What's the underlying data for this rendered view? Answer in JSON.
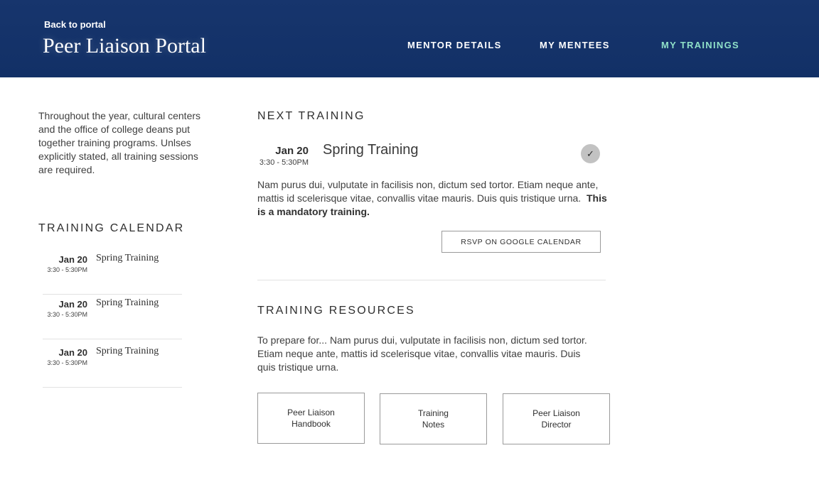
{
  "header": {
    "back_label": "Back to portal",
    "title": "Peer Liaison Portal",
    "nav": [
      "MENTOR DETAILS",
      "MY MENTEES",
      "MY TRAININGS"
    ],
    "active_nav": "MY TRAININGS",
    "colors": {
      "background": "#17356d",
      "active_nav": "#8fe0c8"
    }
  },
  "sidebar": {
    "intro": "Throughout the year, cultural centers and the office of college deans put together training programs. Unlses explicitly stated, all training sessions are required.",
    "calendar_heading": "TRAINING CALENDAR",
    "calendar": [
      {
        "date": "Jan 20",
        "time": "3:30 - 5:30PM",
        "name": "Spring Training"
      },
      {
        "date": "Jan 20",
        "time": "3:30 - 5:30PM",
        "name": "Spring Training"
      },
      {
        "date": "Jan 20",
        "time": "3:30 - 5:30PM",
        "name": "Spring Training"
      }
    ]
  },
  "next_training": {
    "heading": "NEXT TRAINING",
    "date": "Jan 20",
    "time": "3:30 - 5:30PM",
    "title": "Spring Training",
    "check_icon": "check-icon",
    "description": "Nam purus dui, vulputate in facilisis non, dictum sed tortor. Etiam neque ante, mattis id scelerisque vitae, convallis vitae mauris. Duis quis tristique urna.",
    "mandatory_note": "This is a mandatory training.",
    "rsvp_label": "RSVP ON GOOGLE CALENDAR"
  },
  "resources": {
    "heading": "TRAINING RESOURCES",
    "description": "To prepare for... Nam purus dui, vulputate in facilisis non, dictum sed tortor. Etiam neque ante, mattis id scelerisque vitae, convallis vitae mauris. Duis quis tristique urna.",
    "items": [
      "Peer Liaison\nHandbook",
      "Training\nNotes",
      "Peer Liaison\nDirector"
    ]
  }
}
